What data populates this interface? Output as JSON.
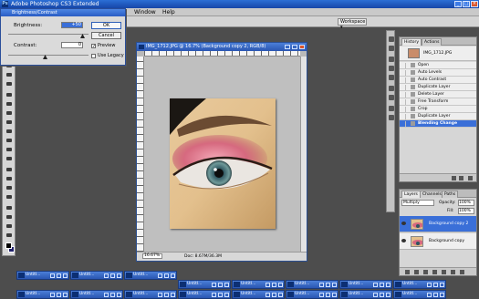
{
  "app": {
    "title": "Adobe Photoshop CS3 Extended"
  },
  "menubar": {
    "window": "Window",
    "help": "Help"
  },
  "options_bar": {
    "workspace": "Workspace ▾"
  },
  "dialog": {
    "title": "Brightness/Contrast",
    "brightness_label": "Brightness:",
    "brightness_value": "+50",
    "contrast_label": "Contrast:",
    "contrast_value": "0",
    "ok": "OK",
    "cancel": "Cancel",
    "preview": "Preview",
    "legacy": "Use Legacy"
  },
  "document": {
    "title": "IMG_1712.JPG @ 16.7% (Background copy 2, RGB/8)",
    "zoom": "16.67%",
    "doc_info": "Doc: 8.67M/36.3M"
  },
  "history": {
    "tabs": [
      "History",
      "Actions"
    ],
    "snapshot": "IMG_1712.JPG",
    "items": [
      "Open",
      "Auto Levels",
      "Auto Contrast",
      "Duplicate Layer",
      "Delete Layer",
      "Free Transform",
      "Crop",
      "Duplicate Layer",
      "Blending Change"
    ],
    "selected_index": 8
  },
  "layers": {
    "tabs": [
      "Layers",
      "Channels",
      "Paths"
    ],
    "blend_mode": "Multiply",
    "opacity_label": "Opacity:",
    "opacity": "100%",
    "fill_label": "Fill:",
    "fill": "100%",
    "items": [
      {
        "name": "Background copy 2"
      },
      {
        "name": "Background copy"
      }
    ]
  },
  "taskbar": {
    "label": "Untitl..."
  },
  "colors": {
    "accent": "#3a6fd8",
    "titlebar": "#2a56b2",
    "panel": "#d6d6d6",
    "workspace_bg": "#4d4d4d"
  }
}
